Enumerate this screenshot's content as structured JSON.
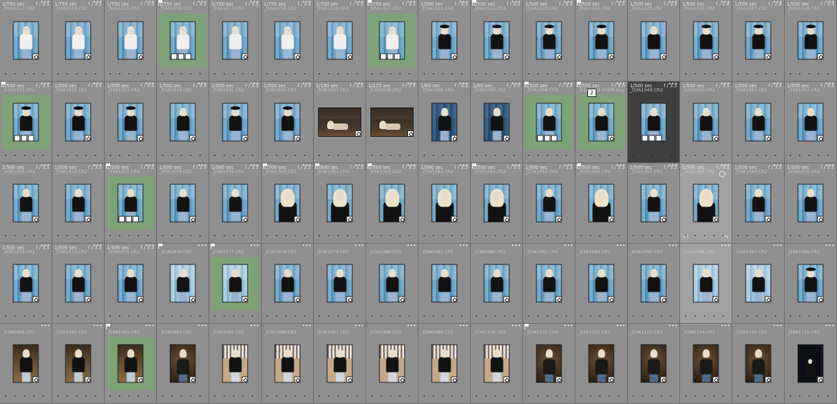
{
  "grid": {
    "ext": "CR2",
    "dot_text": "• • • • •",
    "more_text": "•••",
    "rotate_left_text": "↶",
    "rotate_right_text": "↷",
    "cells": [
      {
        "shutter": "1/750 sec",
        "aperture": "f / 3.5",
        "name": "_D3A1013.CR2",
        "thumb": "white"
      },
      {
        "shutter": "1/750 sec",
        "aperture": "f / 3.5",
        "name": "_D3A1014.CR2",
        "thumb": "white"
      },
      {
        "shutter": "1/750 sec",
        "aperture": "f / 3.5",
        "name": "_D3A1015.CR2",
        "thumb": "white"
      },
      {
        "shutter": "1/750 sec",
        "aperture": "f / 3.5",
        "name": "_D3A1016.CR2",
        "thumb": "white",
        "flag": true,
        "green": true,
        "icons": 3
      },
      {
        "shutter": "1/750 sec",
        "aperture": "f / 3.5",
        "name": "_D3A1017.CR2",
        "thumb": "white"
      },
      {
        "shutter": "1/750 sec",
        "aperture": "f / 3.5",
        "name": "_D3A1018.CR2",
        "thumb": "white"
      },
      {
        "shutter": "1/750 sec",
        "aperture": "f / 3.5",
        "name": "_D3A1019.CR2",
        "thumb": "white"
      },
      {
        "shutter": "1/750 sec",
        "aperture": "f / 3.5",
        "name": "_D3A1020.CR2",
        "thumb": "white",
        "flag": true,
        "green": true,
        "icons": 3
      },
      {
        "shutter": "1/500 sec",
        "aperture": "f / 3.5",
        "name": "_D3A1021.CR2",
        "thumb": "hat"
      },
      {
        "shutter": "1/500 sec",
        "aperture": "f / 3.5",
        "name": "_D3A1022.CR2",
        "thumb": "hat",
        "flag": true
      },
      {
        "shutter": "1/500 sec",
        "aperture": "f / 3.5",
        "name": "_D3A1023.CR2",
        "thumb": "hat"
      },
      {
        "shutter": "1/500 sec",
        "aperture": "f / 3.5",
        "name": "_D3A1024.CR2",
        "thumb": "hat",
        "flag": true
      },
      {
        "shutter": "1/500 sec",
        "aperture": "f / 3.5",
        "name": "_D3A1025.CR2",
        "thumb": "std"
      },
      {
        "shutter": "1/500 sec",
        "aperture": "f / 2.8",
        "name": "_D3A1026.CR2",
        "thumb": "hat"
      },
      {
        "shutter": "1/500 sec",
        "aperture": "f / 2.8",
        "name": "_D3A1027.CR2",
        "thumb": "hat"
      },
      {
        "shutter": "1/500 sec",
        "aperture": "f / 3.5",
        "name": "_D3A1028.CR2",
        "thumb": "hat"
      },
      {
        "shutter": "1/500 sec",
        "aperture": "f / 3.5",
        "name": "_D3A1031.CR2",
        "thumb": "hat",
        "flag": true,
        "green": true,
        "icons": 3
      },
      {
        "shutter": "1/500 sec",
        "aperture": "f / 3.5",
        "name": "_D3A1032.CR2",
        "thumb": "hat"
      },
      {
        "shutter": "1/500 sec",
        "aperture": "f / 3.5",
        "name": "_D3A1033.CR2",
        "thumb": "hat"
      },
      {
        "shutter": "1/500 sec",
        "aperture": "f / 3.5",
        "name": "_D3A1034.CR2",
        "thumb": "std"
      },
      {
        "shutter": "1/500 sec",
        "aperture": "f / 3.5",
        "name": "_D3A1035.CR2",
        "thumb": "hat"
      },
      {
        "shutter": "1/500 sec",
        "aperture": "f / 3.5",
        "name": "_D3A1036.CR2",
        "thumb": "hat"
      },
      {
        "shutter": "1/180 sec",
        "aperture": "f / 2.5",
        "name": "_D3A1037.CR2",
        "thumb": "night",
        "land": true
      },
      {
        "shutter": "1/125 sec",
        "aperture": "f / 2.5",
        "name": "_D3A1038.CR2",
        "thumb": "night",
        "land": true
      },
      {
        "shutter": "1/60 sec",
        "aperture": "f / 3.5",
        "name": "_D3A1039.CR2",
        "thumb": "dark"
      },
      {
        "shutter": "1/60 sec",
        "aperture": "f / 3.5",
        "name": "_D3A1040.CR2",
        "thumb": "dark"
      },
      {
        "shutter": "1/500 sec",
        "aperture": "f / 3.5",
        "name": "_D3A1048.CR2",
        "thumb": "std",
        "flag": true,
        "green": true,
        "icons": 3
      },
      {
        "shutter": "1/500 sec",
        "aperture": "f / 3.5",
        "name": "_D3A1049-1HDR.dng",
        "thumb": "std",
        "flag": true,
        "green": true,
        "stack": "2"
      },
      {
        "shutter": "1/500 sec",
        "aperture": "f / 3.5",
        "name": "_D3A1049.CR2",
        "thumb": "std",
        "highlight": true,
        "icons": 3
      },
      {
        "shutter": "1/500 sec",
        "aperture": "f / 3.5",
        "name": "_D3A1050.CR2",
        "thumb": "std"
      },
      {
        "shutter": "1/500 sec",
        "aperture": "f / 3.5",
        "name": "_D3A1051.CR2",
        "thumb": "std"
      },
      {
        "shutter": "1/500 sec",
        "aperture": "f / 3.5",
        "name": "_D3A1052.CR2",
        "thumb": "std"
      },
      {
        "shutter": "1/500 sec",
        "aperture": "f / 3.5",
        "name": "_D3A1055.CR2",
        "thumb": "std"
      },
      {
        "shutter": "1/500 sec",
        "aperture": "f / 3.5",
        "name": "_D3A1056.CR2",
        "thumb": "std"
      },
      {
        "shutter": "1/500 sec",
        "aperture": "f / 3.5",
        "name": "_D3A1057.CR2",
        "thumb": "std",
        "flag": true,
        "green": true,
        "icons": 3
      },
      {
        "shutter": "1/500 sec",
        "aperture": "f / 3.5",
        "name": "_D3A1058.CR2",
        "thumb": "std"
      },
      {
        "shutter": "1/500 sec",
        "aperture": "f / 3.5",
        "name": "_D3A1059.CR2",
        "thumb": "std"
      },
      {
        "shutter": "1/500 sec",
        "aperture": "f / 3.5",
        "name": "_D3A1060.CR2",
        "thumb": "close",
        "flag": true
      },
      {
        "shutter": "1/500 sec",
        "aperture": "f / 3.5",
        "name": "_D3A1061.CR2",
        "thumb": "close",
        "flag": true
      },
      {
        "shutter": "1/500 sec",
        "aperture": "f / 3.5",
        "name": "_D3A1062.CR2",
        "thumb": "close",
        "flag": true
      },
      {
        "shutter": "1/500 sec",
        "aperture": "f / 3.5",
        "name": "_D3A1063.CR2",
        "thumb": "close"
      },
      {
        "shutter": "1/500 sec",
        "aperture": "f / 3.5",
        "name": "_D3A1064.CR2",
        "thumb": "close",
        "flag": true
      },
      {
        "shutter": "1/500 sec",
        "aperture": "f / 3.5",
        "name": "_D3A1065.CR2",
        "thumb": "std"
      },
      {
        "shutter": "1/500 sec",
        "aperture": "f / 3.5",
        "name": "_D3A1066.CR2",
        "thumb": "close",
        "flag": true
      },
      {
        "shutter": "1/500 sec",
        "aperture": "f / 3.5",
        "name": "_D3A1067.CR2",
        "thumb": "std"
      },
      {
        "shutter": "1/500 sec",
        "aperture": "f / 3.5",
        "name": "_D3A1068.CR2",
        "thumb": "close",
        "selected": true,
        "rotate": true
      },
      {
        "shutter": "1/500 sec",
        "aperture": "f / 3.5",
        "name": "_D3A1069.CR2",
        "thumb": "std"
      },
      {
        "shutter": "1/500 sec",
        "aperture": "f / 3.5",
        "name": "_D3A1070.CR2",
        "thumb": "std"
      },
      {
        "shutter": "1/500 sec",
        "aperture": "f / 3.5",
        "name": "_D3A1073.CR2",
        "thumb": "std"
      },
      {
        "shutter": "1/500 sec",
        "aperture": "f / 3.5",
        "name": "_D3A1074.CR2",
        "thumb": "std"
      },
      {
        "shutter": "1/500 sec",
        "aperture": "f / 3.5",
        "name": "_D3A1075.CR2",
        "thumb": "std"
      },
      {
        "name": "_D3A1076.CR2",
        "thumb": "light",
        "flag": true
      },
      {
        "name": "_D3A1077.CR2",
        "thumb": "light",
        "flag": true,
        "green": true
      },
      {
        "name": "_D3A1078.CR2",
        "thumb": "std"
      },
      {
        "name": "_D3A1079.CR2",
        "thumb": "std"
      },
      {
        "name": "_D3A1080.CR2",
        "thumb": "std"
      },
      {
        "name": "_D3A1081.CR2",
        "thumb": "std"
      },
      {
        "name": "_D3A1082.CR2",
        "thumb": "std"
      },
      {
        "name": "_D3A1083.CR2",
        "thumb": "std"
      },
      {
        "name": "_D3A1084.CR2",
        "thumb": "std"
      },
      {
        "name": "_D3A1085.CR2",
        "thumb": "std"
      },
      {
        "name": "_D3A1086.CR2",
        "thumb": "light",
        "selected": true
      },
      {
        "name": "_D3A1087.CR2",
        "thumb": "light"
      },
      {
        "name": "_D3A1088.CR2",
        "thumb": "hat"
      },
      {
        "name": "_D3A1091.CR2",
        "thumb": "brown"
      },
      {
        "name": "_D3A1092.CR2",
        "thumb": "brown"
      },
      {
        "name": "_D3A1093.CR2",
        "thumb": "brown",
        "flag": true,
        "green": true
      },
      {
        "name": "_D3A1094.CR2",
        "thumb": "studio"
      },
      {
        "name": "_D3A1095.CR2",
        "thumb": "sand"
      },
      {
        "name": "_D3A1096.CR2",
        "thumb": "sand"
      },
      {
        "name": "_D3A1097.CR2",
        "thumb": "sand"
      },
      {
        "name": "_D3A1098.CR2",
        "thumb": "sand"
      },
      {
        "name": "_D3A1099.CR2",
        "thumb": "sand"
      },
      {
        "name": "_D3A1100.CR2",
        "thumb": "sand"
      },
      {
        "name": "_D3A1101.CR2",
        "thumb": "studio",
        "flag": true
      },
      {
        "name": "_D3A1102.CR2",
        "thumb": "studio"
      },
      {
        "name": "_D3A1103.CR2",
        "thumb": "studio"
      },
      {
        "name": "_D3A1104.CR2",
        "thumb": "studio"
      },
      {
        "name": "_D3A1105.CR2",
        "thumb": "studio"
      },
      {
        "name": "_D3A1110.CR2",
        "thumb": "black"
      }
    ]
  }
}
